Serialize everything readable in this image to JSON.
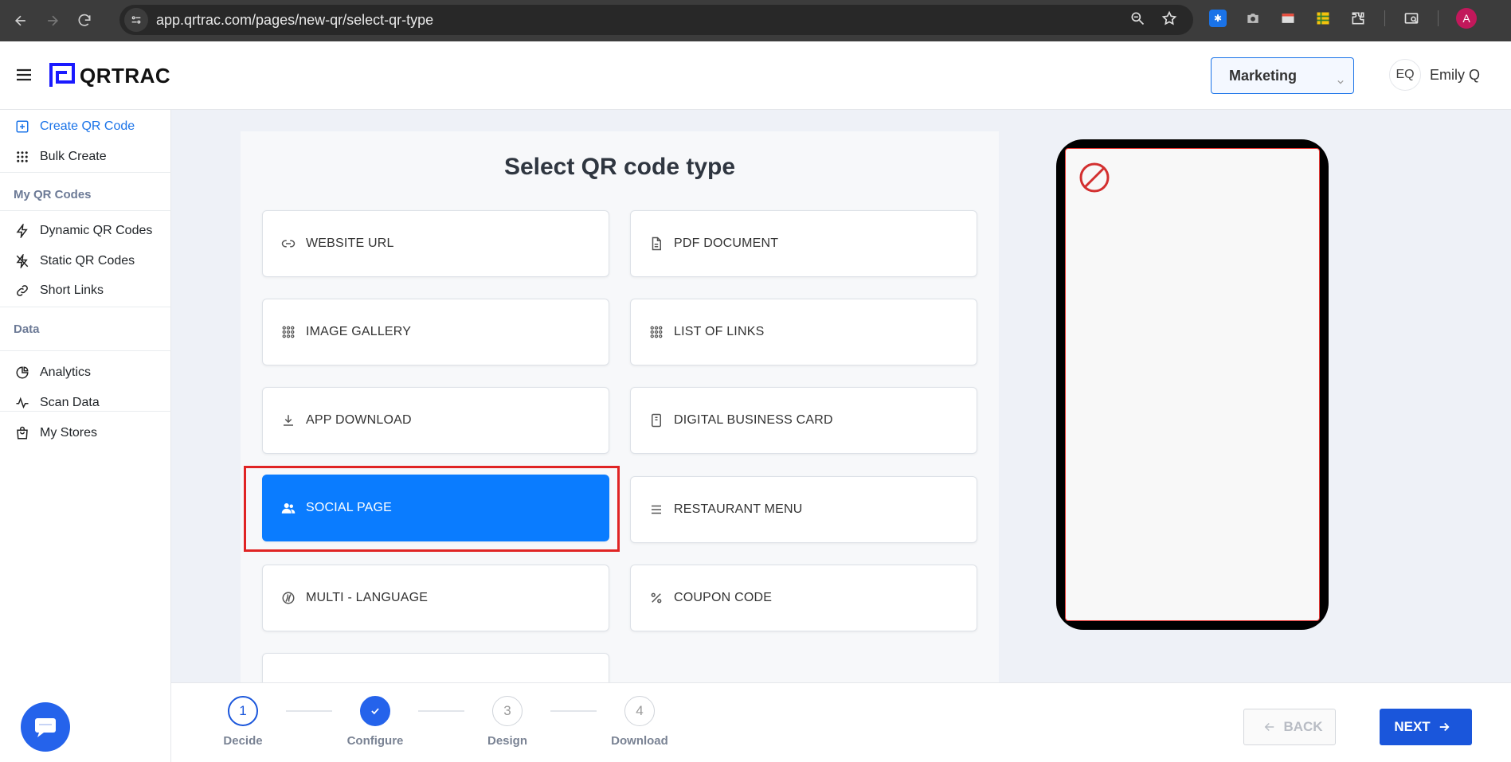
{
  "browser": {
    "url": "app.qrtrac.com/pages/new-qr/select-qr-type",
    "profile_initial": "A"
  },
  "header": {
    "logo_text": "QRTRAC",
    "workspace": "Marketing",
    "user_initials": "EQ",
    "user_name": "Emily Q"
  },
  "sidebar": {
    "items": [
      {
        "label": "Create QR Code"
      },
      {
        "label": "Bulk Create"
      }
    ],
    "section_my_qr": "My QR Codes",
    "my_qr_items": [
      {
        "label": "Dynamic QR Codes"
      },
      {
        "label": "Static QR Codes"
      },
      {
        "label": "Short Links"
      }
    ],
    "section_data": "Data",
    "data_items": [
      {
        "label": "Analytics"
      },
      {
        "label": "Scan Data"
      },
      {
        "label": "My Stores"
      }
    ]
  },
  "main": {
    "title": "Select QR code type",
    "types": [
      {
        "label": "WEBSITE URL",
        "icon": "link-icon"
      },
      {
        "label": "PDF DOCUMENT",
        "icon": "document-icon"
      },
      {
        "label": "IMAGE GALLERY",
        "icon": "grid-icon"
      },
      {
        "label": "LIST OF LINKS",
        "icon": "grid-icon"
      },
      {
        "label": "APP DOWNLOAD",
        "icon": "download-icon"
      },
      {
        "label": "DIGITAL BUSINESS CARD",
        "icon": "card-icon"
      },
      {
        "label": "SOCIAL PAGE",
        "icon": "users-icon",
        "selected": true
      },
      {
        "label": "RESTAURANT MENU",
        "icon": "menu-lines-icon"
      },
      {
        "label": "MULTI - LANGUAGE",
        "icon": "language-icon"
      },
      {
        "label": "COUPON CODE",
        "icon": "percent-icon"
      }
    ]
  },
  "stepper": {
    "steps": [
      {
        "number": "1",
        "label": "Decide",
        "state": "current"
      },
      {
        "number": "",
        "label": "Configure",
        "state": "done"
      },
      {
        "number": "3",
        "label": "Design",
        "state": "pending"
      },
      {
        "number": "4",
        "label": "Download",
        "state": "pending"
      }
    ],
    "back_label": "BACK",
    "next_label": "NEXT"
  },
  "colors": {
    "accent": "#1a56db",
    "selected": "#0a7cff",
    "highlight": "#e02424"
  }
}
